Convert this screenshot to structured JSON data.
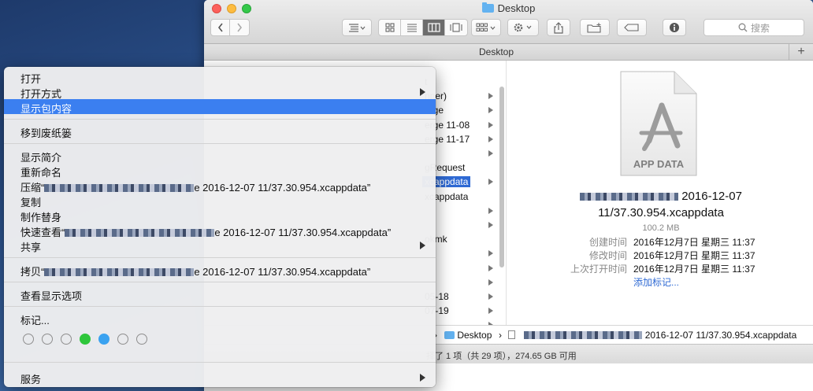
{
  "window": {
    "title": "Desktop",
    "tab_title": "Desktop",
    "search_placeholder": "搜索"
  },
  "column_items": [
    {
      "label": "t",
      "arrow": false
    },
    {
      "label": "nner)",
      "arrow": true
    },
    {
      "label": "erge",
      "arrow": true
    },
    {
      "label": "erge 11-08",
      "arrow": true
    },
    {
      "label": "erge 11-17",
      "arrow": true
    },
    {
      "label": "",
      "arrow": true
    },
    {
      "label": "gRequest",
      "arrow": false
    },
    {
      "label": "xcappdata",
      "arrow": true,
      "selected": true
    },
    {
      "label": "xcappdata",
      "arrow": false
    },
    {
      "label": "",
      "arrow": true
    },
    {
      "label": "",
      "arrow": true
    },
    {
      "label": "okmk",
      "arrow": false
    },
    {
      "label": "",
      "arrow": true
    },
    {
      "label": "",
      "arrow": true
    },
    {
      "label": "",
      "arrow": true
    },
    {
      "label": "05-18",
      "arrow": true
    },
    {
      "label": "07-19",
      "arrow": true
    },
    {
      "label": "",
      "arrow": true
    }
  ],
  "preview": {
    "icon_label": "APP DATA",
    "file_name_line1": "2016-12-07",
    "file_name_line2": "11/37.30.954.xcappdata",
    "file_size": "100.2 MB",
    "meta": [
      {
        "key": "创建时间",
        "value": "2016年12月7日 星期三 11:37"
      },
      {
        "key": "修改时间",
        "value": "2016年12月7日 星期三 11:37"
      },
      {
        "key": "上次打开时间",
        "value": "2016年12月7日 星期三 11:37"
      }
    ],
    "add_tags": "添加标记..."
  },
  "path_bar": {
    "folder": "Desktop",
    "file": "2016-12-07 11/37.30.954.xcappdata"
  },
  "status_bar": "择了 1 项（共 29 项），274.65 GB 可用",
  "context_menu": {
    "open": "打开",
    "open_with": "打开方式",
    "show_package_contents": "显示包内容",
    "move_to_trash": "移到废纸篓",
    "get_info": "显示简介",
    "rename": "重新命名",
    "compress": "压缩“",
    "compress_suffix": "e 2016-12-07 11/37.30.954.xcappdata”",
    "duplicate": "复制",
    "make_alias": "制作替身",
    "quick_look": "快速查看“",
    "quick_look_suffix": "e 2016-12-07 11/37.30.954.xcappdata”",
    "share": "共享",
    "copy": "拷贝“",
    "copy_suffix": "e 2016-12-07 11/37.30.954.xcappdata”",
    "view_options": "查看显示选项",
    "tags": "标记...",
    "services": "服务"
  },
  "tag_colors": [
    "#ffffff",
    "#ffffff",
    "#ffffff",
    "#2ec63b",
    "#3aa2f0",
    "#ffffff",
    "#ffffff"
  ],
  "colors": {
    "highlight": "#3b7ff0",
    "selection": "#2f6ad4"
  }
}
